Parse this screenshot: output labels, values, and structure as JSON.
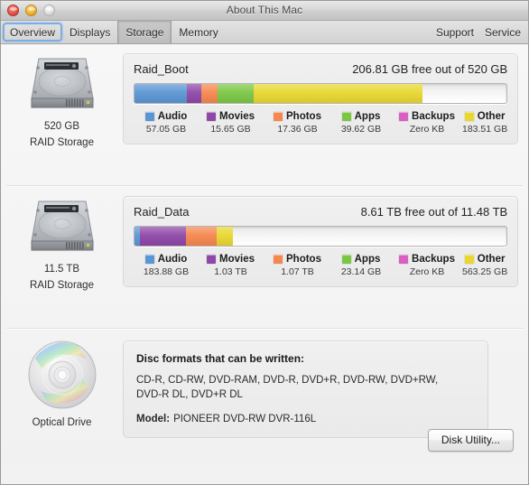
{
  "window": {
    "title": "About This Mac",
    "controls": {
      "close": "close-button",
      "minimize": "minimize-button",
      "zoom": "zoom-button"
    }
  },
  "toolbar": {
    "tabs": [
      {
        "label": "Overview",
        "state": "focused"
      },
      {
        "label": "Displays",
        "state": "normal"
      },
      {
        "label": "Storage",
        "state": "selected"
      },
      {
        "label": "Memory",
        "state": "normal"
      }
    ],
    "links": [
      {
        "label": "Support"
      },
      {
        "label": "Service"
      }
    ]
  },
  "colors": {
    "audio": "#5b96d4",
    "movies": "#8f48a8",
    "photos": "#f5874f",
    "apps": "#7ac745",
    "backups": "#d95fc0",
    "other": "#e8d730",
    "free": "#eeeeee",
    "accent": "#7aaee8"
  },
  "drives": [
    {
      "icon": "hard-disk-icon",
      "capacity_label": "520 GB",
      "type_label": "RAID Storage",
      "volume_name": "Raid_Boot",
      "free_text": "206.81 GB free out of 520 GB",
      "segments": [
        {
          "name": "Audio",
          "size": "57.05 GB",
          "color": "#5b96d4",
          "percent": 14.1
        },
        {
          "name": "Movies",
          "size": "15.65 GB",
          "color": "#8f48a8",
          "percent": 3.9
        },
        {
          "name": "Photos",
          "size": "17.36 GB",
          "color": "#f5874f",
          "percent": 4.3
        },
        {
          "name": "Apps",
          "size": "39.62 GB",
          "color": "#7ac745",
          "percent": 9.8
        },
        {
          "name": "Backups",
          "size": "Zero KB",
          "color": "#d95fc0",
          "percent": 0
        },
        {
          "name": "Other",
          "size": "183.51 GB",
          "color": "#e8d730",
          "percent": 45.3
        }
      ]
    },
    {
      "icon": "hard-disk-icon",
      "capacity_label": "11.5 TB",
      "type_label": "RAID Storage",
      "volume_name": "Raid_Data",
      "free_text": "8.61 TB free out of 11.48 TB",
      "segments": [
        {
          "name": "Audio",
          "size": "183.88 GB",
          "color": "#5b96d4",
          "percent": 1.4
        },
        {
          "name": "Movies",
          "size": "1.03 TB",
          "color": "#8f48a8",
          "percent": 12.5
        },
        {
          "name": "Photos",
          "size": "1.07 TB",
          "color": "#f5874f",
          "percent": 8.2
        },
        {
          "name": "Apps",
          "size": "23.14 GB",
          "color": "#7ac745",
          "percent": 0
        },
        {
          "name": "Backups",
          "size": "Zero KB",
          "color": "#d95fc0",
          "percent": 0
        },
        {
          "name": "Other",
          "size": "563.25 GB",
          "color": "#e8d730",
          "percent": 4.4
        }
      ]
    }
  ],
  "optical": {
    "icon": "optical-disc-icon",
    "label": "Optical Drive",
    "formats_title": "Disc formats that can be written:",
    "formats": "CD-R, CD-RW, DVD-RAM, DVD-R, DVD+R, DVD-RW, DVD+RW, DVD-R DL, DVD+R DL",
    "model_label": "Model:",
    "model_value": "PIONEER DVD-RW DVR-116L"
  },
  "footer": {
    "disk_utility_label": "Disk Utility..."
  }
}
